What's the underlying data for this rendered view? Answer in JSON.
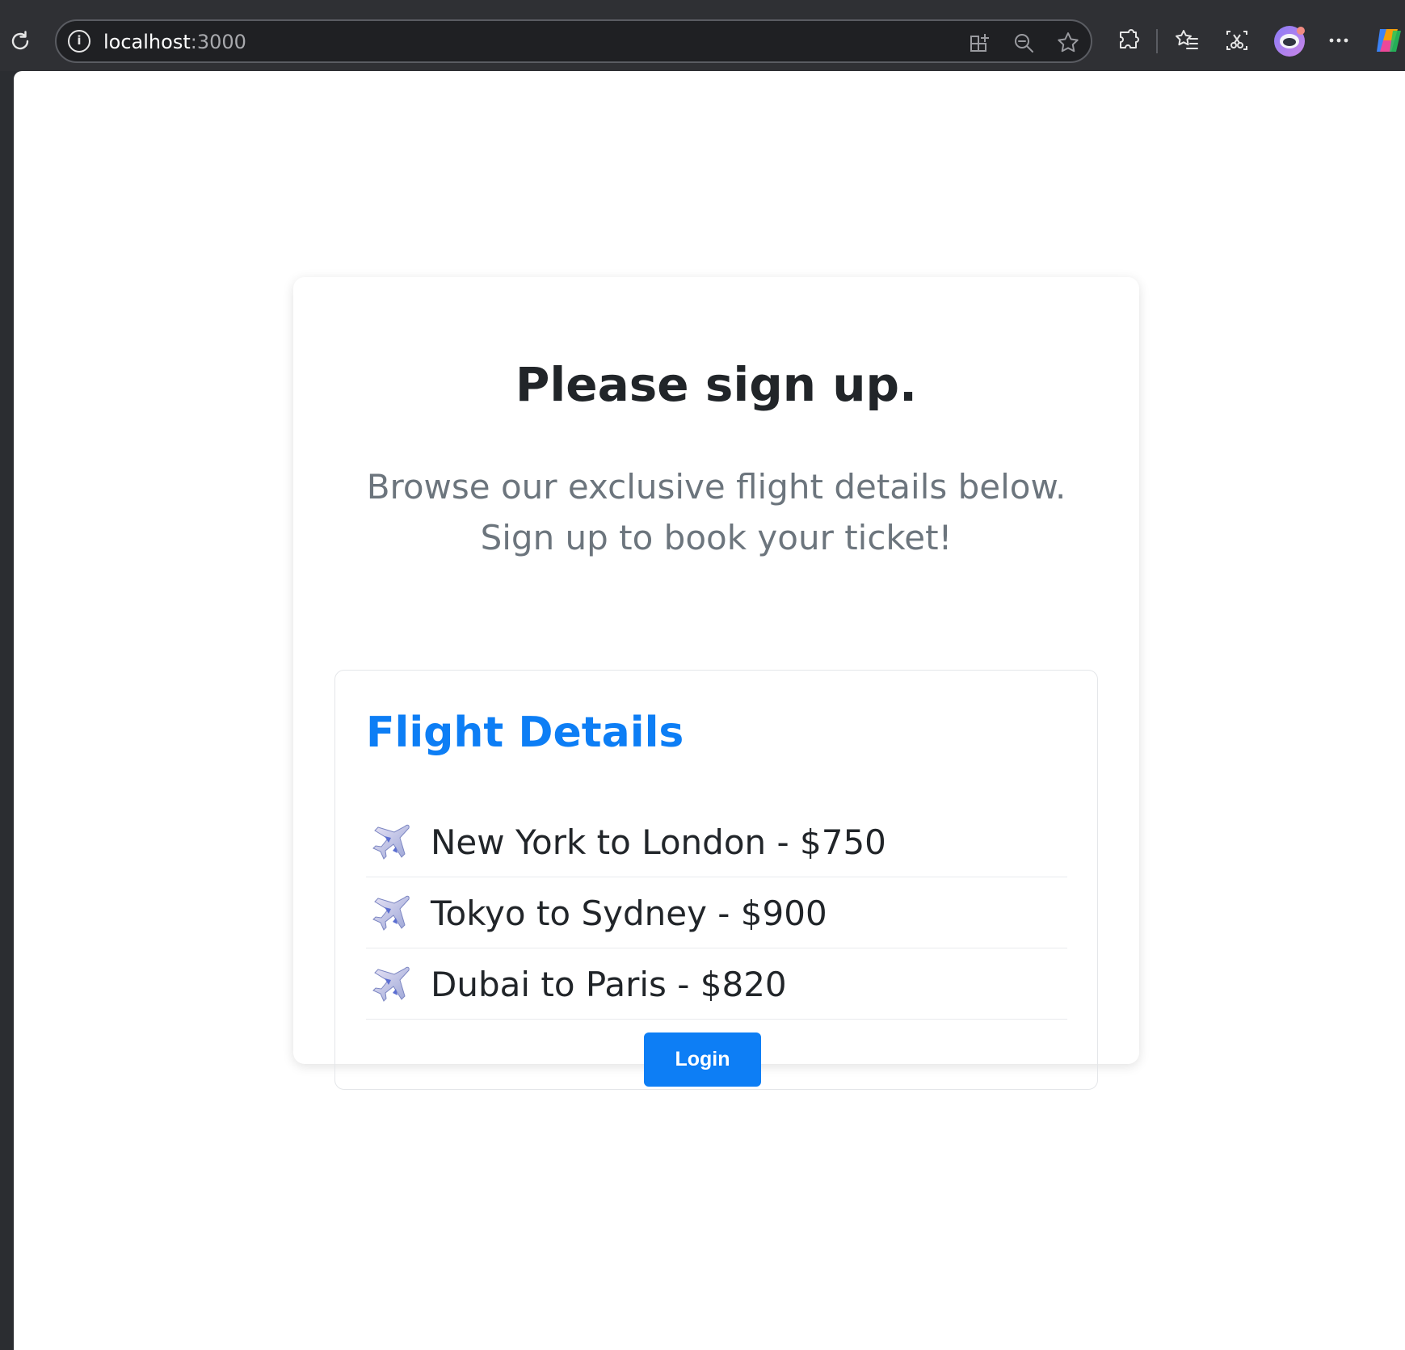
{
  "browser": {
    "url_host": "localhost",
    "url_port": ":3000",
    "icons": [
      "reload-icon",
      "site-info-icon",
      "app-grid-icon",
      "zoom-out-icon",
      "bookmark-star-icon",
      "extensions-icon",
      "favorites-icon",
      "screenshot-icon",
      "profile-avatar-icon",
      "more-menu-icon",
      "copilot-icon"
    ]
  },
  "page": {
    "heading": "Please sign up.",
    "subtitle": "Browse our exclusive flight details below. Sign up to book your ticket!",
    "flight_details": {
      "title": "Flight Details",
      "flights": [
        {
          "text": "New York to London - $750"
        },
        {
          "text": "Tokyo to Sydney - $900"
        },
        {
          "text": "Dubai to Paris - $820"
        }
      ]
    },
    "login_label": "Login"
  },
  "colors": {
    "primary": "#0d7ef5",
    "heading": "#212529",
    "muted": "#6c757d",
    "chrome_bg": "#2f3034"
  }
}
